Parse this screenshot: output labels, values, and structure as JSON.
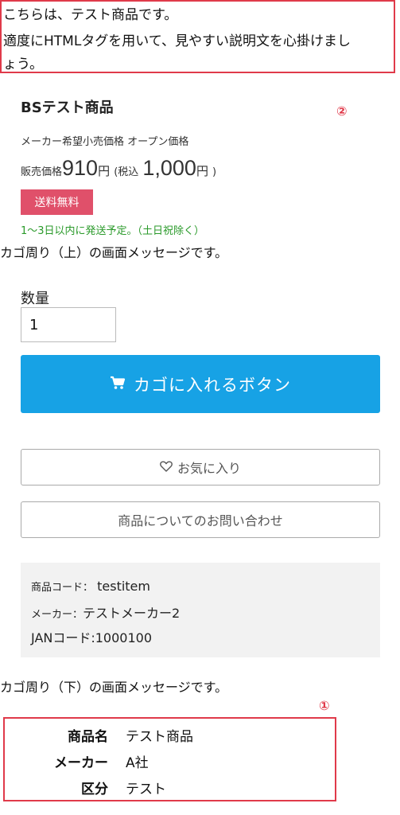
{
  "description": {
    "line1": "こちらは、テスト商品です。",
    "line2": "適度にHTMLタグを用いて、見やすい説明文を心掛けまし",
    "line3": "ょう。"
  },
  "markers": {
    "two": "②",
    "one": "①"
  },
  "product": {
    "name": "BSテスト商品",
    "maker_price": "メーカー希望小売価格 オープン価格",
    "price_label": "販売価格",
    "price_value": "910",
    "price_unit": "円",
    "tax_open": "(税込",
    "tax_value": "1,000",
    "tax_close": ")",
    "free_shipping": "送料無料",
    "shipping_note": "1～3日以内に発送予定。（土日祝除く）"
  },
  "cart": {
    "message_top": "カゴ周り（上）の画面メッセージです。",
    "qty_label": "数量",
    "qty_value": "1",
    "add_button": "カゴに入れるボタン",
    "favorite_button": "お気に入り",
    "inquiry_button": "商品についてのお問い合わせ",
    "message_bottom": "カゴ周り（下）の画面メッセージです。"
  },
  "info": {
    "code_key": "商品コード：",
    "code_value": "testitem",
    "maker_key": "メーカー：",
    "maker_value": "テストメーカー2",
    "jan_key": "JANコード:",
    "jan_value": "1000100"
  },
  "specs": [
    {
      "key": "商品名",
      "value": "テスト商品"
    },
    {
      "key": "メーカー",
      "value": "A社"
    },
    {
      "key": "区分",
      "value": "テスト"
    }
  ],
  "colors": {
    "accent_red": "#e03a4a",
    "cart_blue": "#17a2e5",
    "free_ship_pink": "#e0506a",
    "ship_note_green": "#2a9a2a"
  },
  "icons": [
    "cart-icon",
    "heart-icon"
  ]
}
